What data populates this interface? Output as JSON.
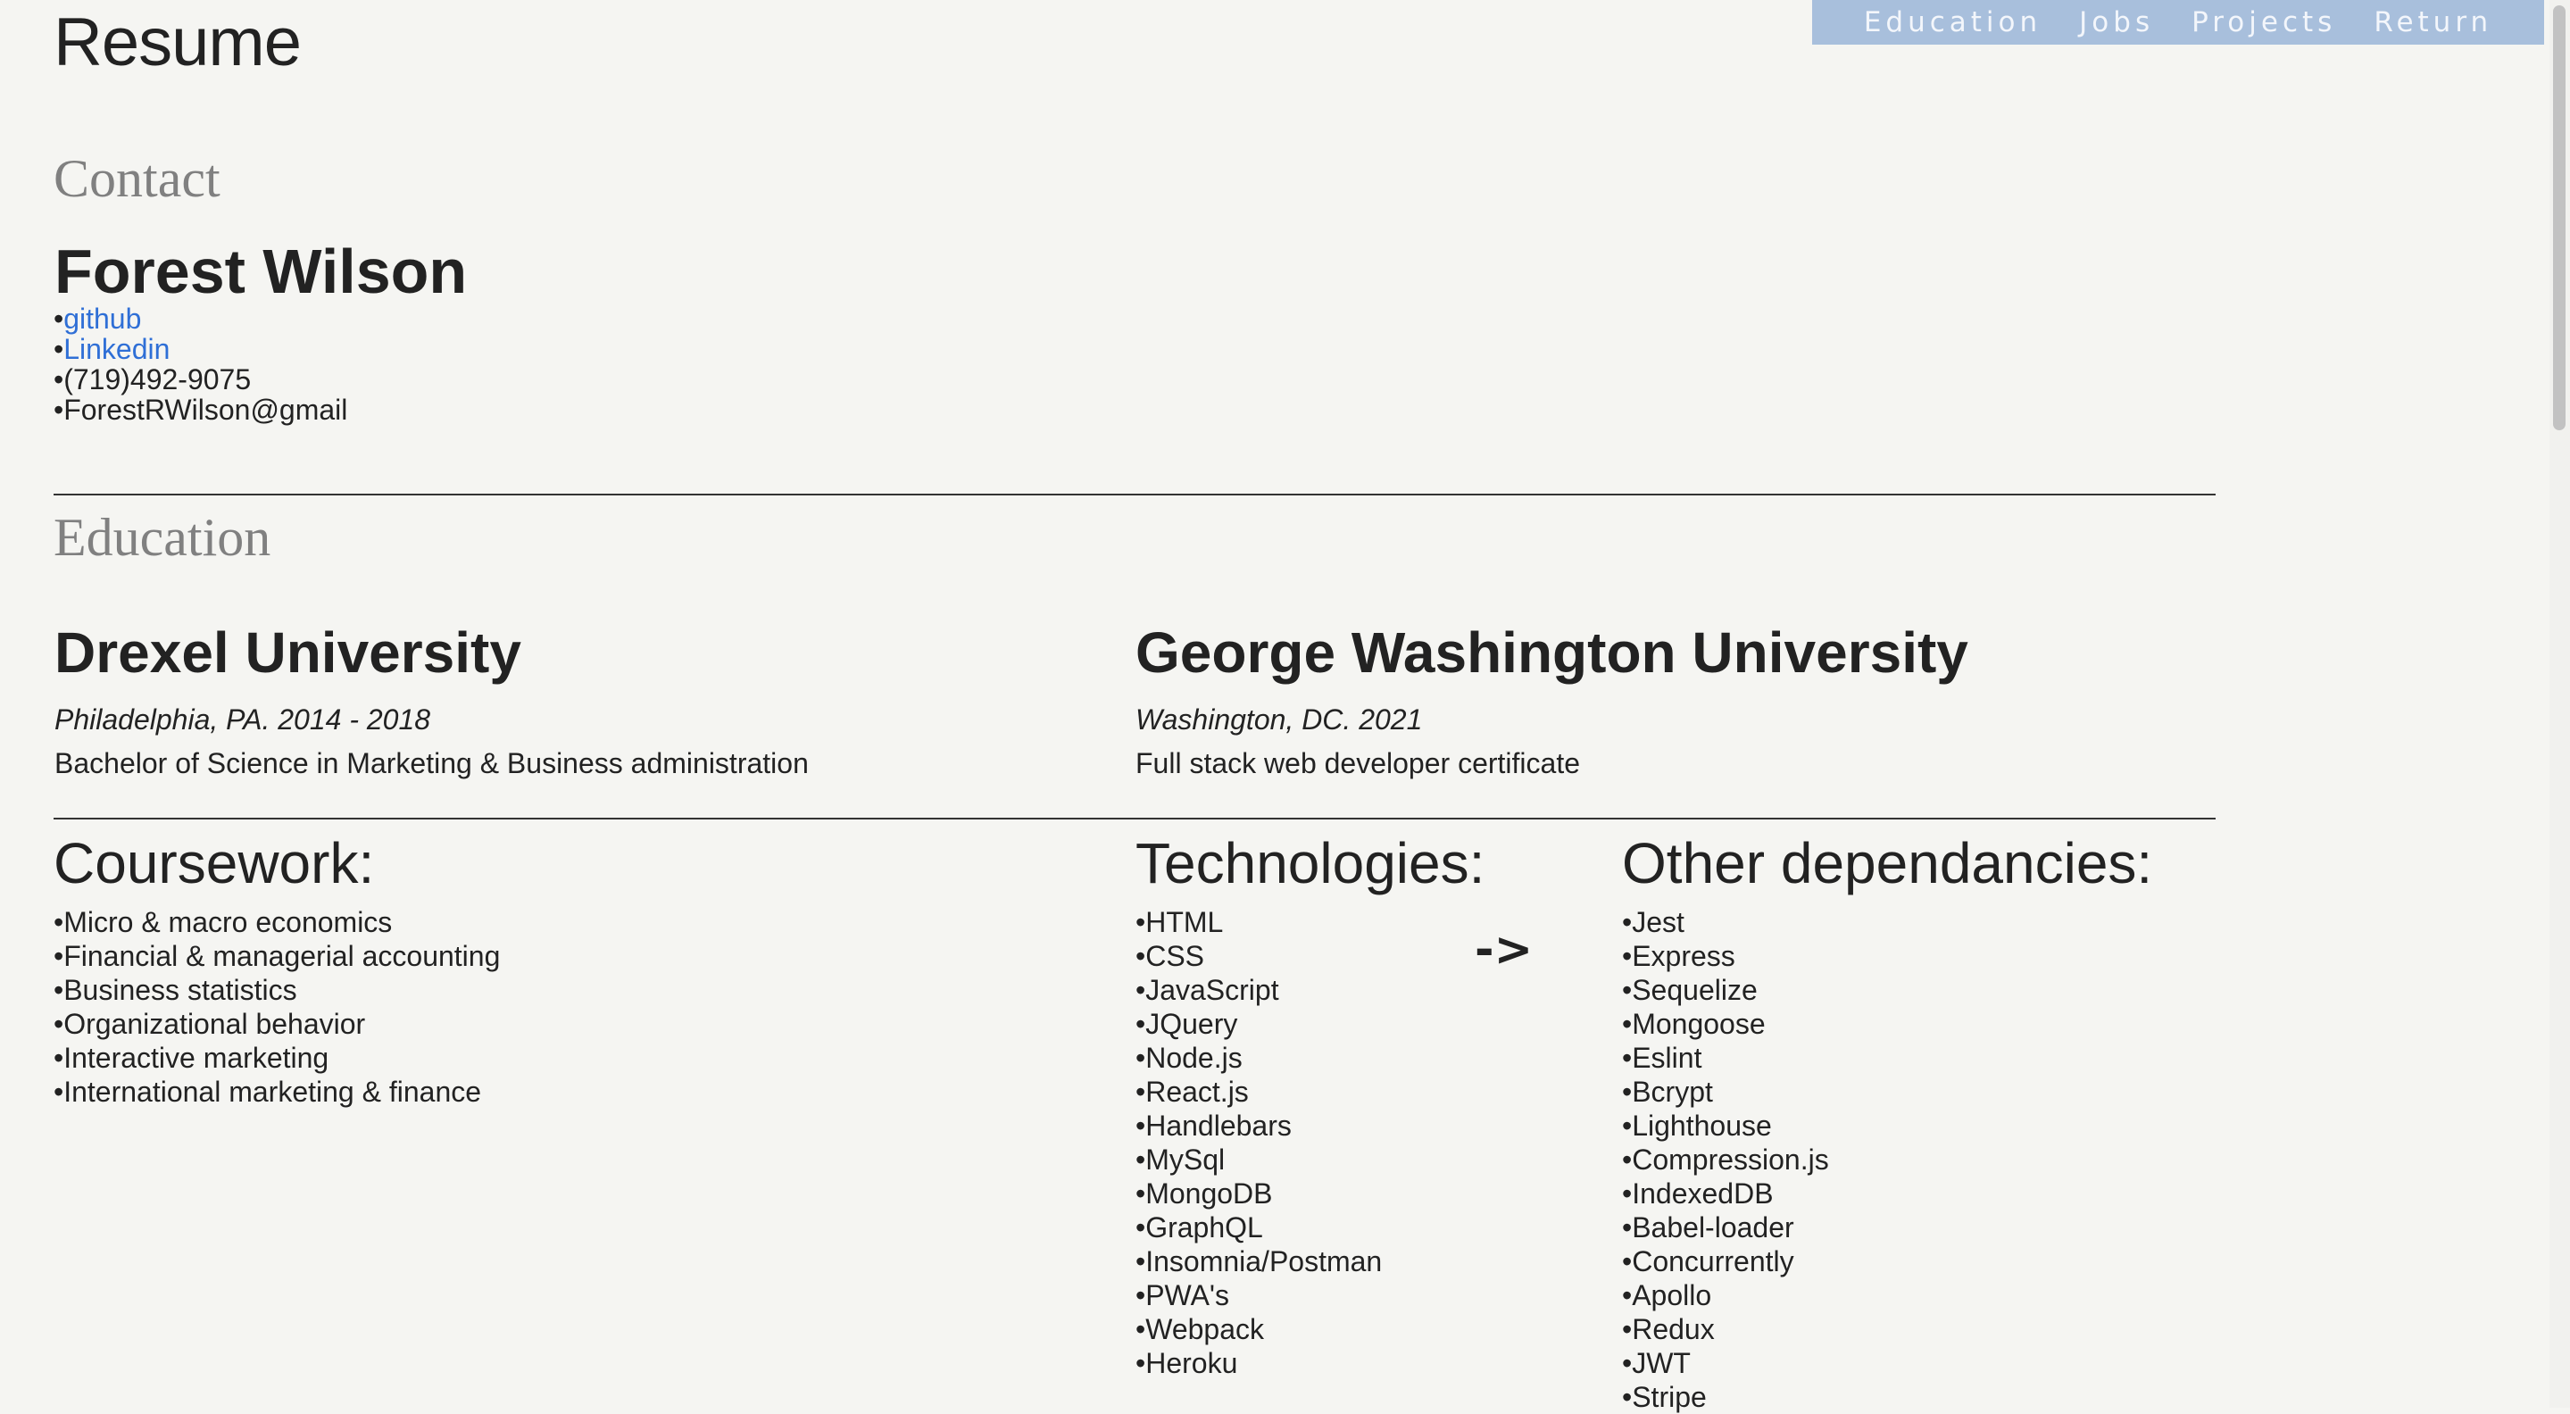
{
  "nav": {
    "items": [
      "Education",
      "Jobs",
      "Projects",
      "Return"
    ]
  },
  "page_title": "Resume",
  "contact": {
    "heading": "Contact",
    "name": "Forest Wilson",
    "items": [
      "github",
      "Linkedin",
      "(719)492-9075",
      "ForestRWilson@gmail"
    ]
  },
  "education": {
    "heading": "Education",
    "schools": [
      {
        "name": "Drexel University",
        "place": "Philadelphia, PA. 2014 - 2018",
        "degree": "Bachelor of Science in Marketing & Business administration"
      },
      {
        "name": "George Washington University",
        "place": "Washington, DC. 2021",
        "degree": "Full stack web developer certificate"
      }
    ]
  },
  "coursework": {
    "heading": "Coursework:",
    "items": [
      "Micro & macro economics",
      "Financial & managerial accounting",
      "Business statistics",
      "Organizational behavior",
      "Interactive marketing",
      "International marketing & finance"
    ]
  },
  "technologies": {
    "heading": "Technologies:",
    "items": [
      "HTML",
      "CSS",
      "JavaScript",
      "JQuery",
      "Node.js",
      "React.js",
      "Handlebars",
      "MySql",
      "MongoDB",
      "GraphQL",
      "Insomnia/Postman",
      "PWA's",
      "Webpack",
      "Heroku"
    ]
  },
  "arrow": "->",
  "dependencies": {
    "heading": "Other dependancies:",
    "items": [
      "Jest",
      "Express",
      "Sequelize",
      "Mongoose",
      "Eslint",
      "Bcrypt",
      "Lighthouse",
      "Compression.js",
      "IndexedDB",
      "Babel-loader",
      "Concurrently",
      "Apollo",
      "Redux",
      "JWT",
      "Stripe"
    ]
  },
  "bullet": "•"
}
